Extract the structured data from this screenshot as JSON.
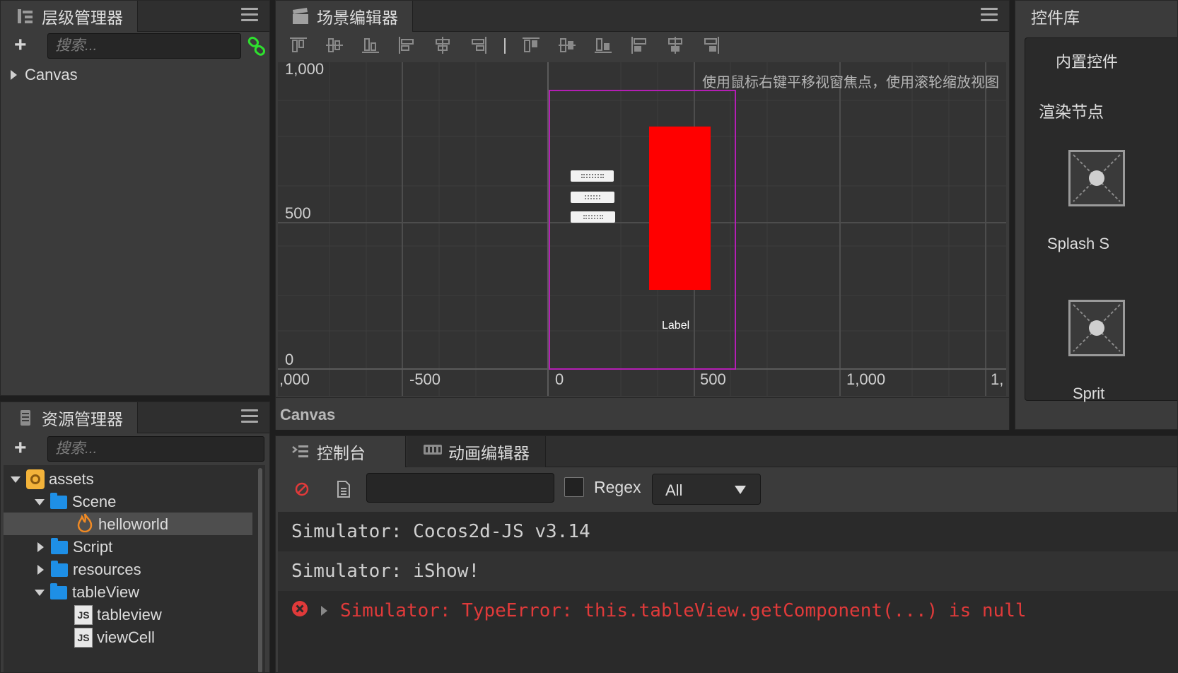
{
  "hierarchy": {
    "title": "层级管理器",
    "search_placeholder": "搜索...",
    "tree": [
      {
        "label": "Canvas"
      }
    ]
  },
  "scene": {
    "title": "场景编辑器",
    "hint": "使用鼠标右键平移视窗焦点，使用滚轮缩放视图",
    "y_ticks": [
      "1,000",
      "500",
      "0"
    ],
    "x_ticks": [
      ",000",
      "-500",
      "0",
      "500",
      "1,000",
      "1,"
    ],
    "node_label": "Label",
    "status_path": "Canvas",
    "colors": {
      "selection": "#b41eb4",
      "red_node": "#ff0000"
    }
  },
  "widgets": {
    "title": "控件库",
    "section_builtin": "内置控件",
    "section_render": "渲染节点",
    "items": [
      "Splash S",
      "Sprit"
    ]
  },
  "assets": {
    "title": "资源管理器",
    "search_placeholder": "搜索...",
    "tree": [
      {
        "label": "assets"
      },
      {
        "label": "Scene"
      },
      {
        "label": "helloworld"
      },
      {
        "label": "Script"
      },
      {
        "label": "resources"
      },
      {
        "label": "tableView"
      },
      {
        "label": "tableview"
      },
      {
        "label": "viewCell"
      }
    ]
  },
  "console": {
    "tab_console": "控制台",
    "tab_animation": "动画编辑器",
    "filter_value": "",
    "regex_label": "Regex",
    "level_selected": "All",
    "lines": [
      {
        "text": "Simulator: Cocos2d-JS v3.14"
      },
      {
        "text": "Simulator: iShow!"
      },
      {
        "text": "Simulator: TypeError: this.tableView.getComponent(...) is null"
      }
    ],
    "colors": {
      "error": "#e03a3a"
    }
  }
}
